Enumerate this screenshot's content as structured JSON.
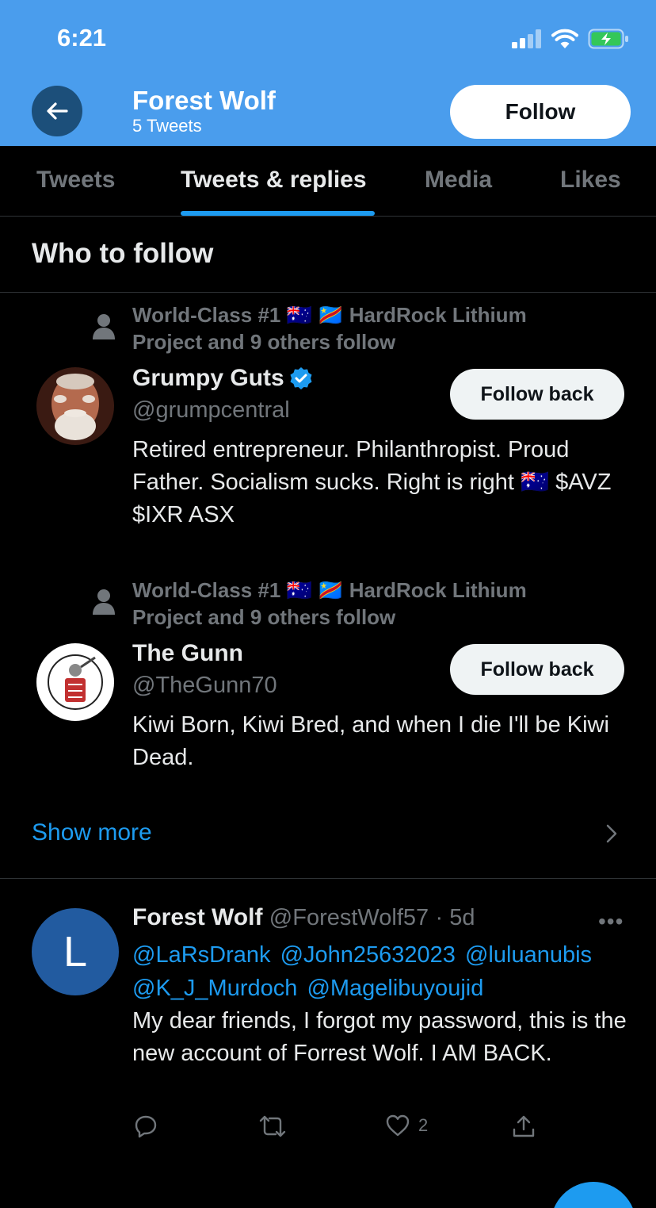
{
  "status_bar": {
    "time": "6:21"
  },
  "header": {
    "name": "Forest Wolf",
    "tweet_count": "5 Tweets",
    "follow_label": "Follow",
    "accent": "#4a9ded"
  },
  "tabs": [
    {
      "label": "Tweets",
      "active": false
    },
    {
      "label": "Tweets & replies",
      "active": true
    },
    {
      "label": "Media",
      "active": false
    },
    {
      "label": "Likes",
      "active": false
    }
  ],
  "who_to_follow": {
    "title": "Who to follow",
    "suggestions": [
      {
        "context_line1": "World-Class #1 🇦🇺 🇨🇩 HardRock Lithium",
        "context_line2": "Project and 9 others follow",
        "name": "Grumpy Guts",
        "verified": true,
        "handle": "@grumpcentral",
        "bio": "Retired entrepreneur. Philanthropist. Proud Father. Socialism sucks. Right is right 🇦🇺 $AVZ $IXR ASX",
        "button": "Follow back"
      },
      {
        "context_line1": "World-Class #1 🇦🇺 🇨🇩 HardRock Lithium",
        "context_line2": "Project and 9 others follow",
        "name": "The Gunn",
        "verified": false,
        "handle": "@TheGunn70",
        "bio": "Kiwi Born, Kiwi Bred, and when I die I'll be Kiwi Dead.",
        "button": "Follow back"
      }
    ],
    "show_more": "Show more"
  },
  "tweet": {
    "avatar_letter": "L",
    "name": "Forest Wolf",
    "handle": "@ForestWolf57",
    "time": "· 5d",
    "more": "•••",
    "mentions": [
      "@LaRsDrank",
      "@John25632023",
      "@luluanubis",
      "@K_J_Murdoch",
      "@Magelibuyoujid"
    ],
    "text": "My dear friends, I forgot my password, this is the new account of Forrest Wolf. I AM BACK.",
    "like_count": "2"
  },
  "colors": {
    "link": "#1d9bf0",
    "muted": "#71767b",
    "background": "#000000"
  }
}
